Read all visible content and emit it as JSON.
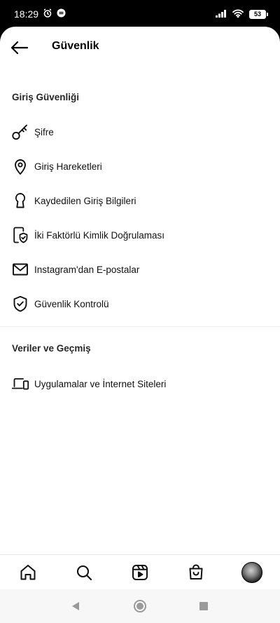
{
  "status_bar": {
    "time": "18:29",
    "battery": "53"
  },
  "header": {
    "title": "Güvenlik"
  },
  "sections": {
    "login_security": {
      "title": "Giriş Güvenliği",
      "items": [
        {
          "label": "Şifre",
          "icon": "key-icon"
        },
        {
          "label": "Giriş Hareketleri",
          "icon": "location-pin-icon"
        },
        {
          "label": "Kaydedilen Giriş Bilgileri",
          "icon": "keyhole-icon"
        },
        {
          "label": "İki Faktörlü Kimlik Doğrulaması",
          "icon": "device-shield-icon"
        },
        {
          "label": "Instagram'dan E-postalar",
          "icon": "envelope-icon"
        },
        {
          "label": "Güvenlik Kontrolü",
          "icon": "shield-check-icon"
        }
      ]
    },
    "data_history": {
      "title": "Veriler ve Geçmiş",
      "items": [
        {
          "label": "Uygulamalar ve İnternet Siteleri",
          "icon": "laptop-phone-icon"
        }
      ]
    }
  },
  "bottom_nav": {
    "items": [
      "home-icon",
      "search-icon",
      "reels-icon",
      "shop-icon",
      "profile-avatar"
    ]
  },
  "system_nav": {
    "items": [
      "back-triangle-icon",
      "home-circle-icon",
      "recents-square-icon"
    ]
  }
}
